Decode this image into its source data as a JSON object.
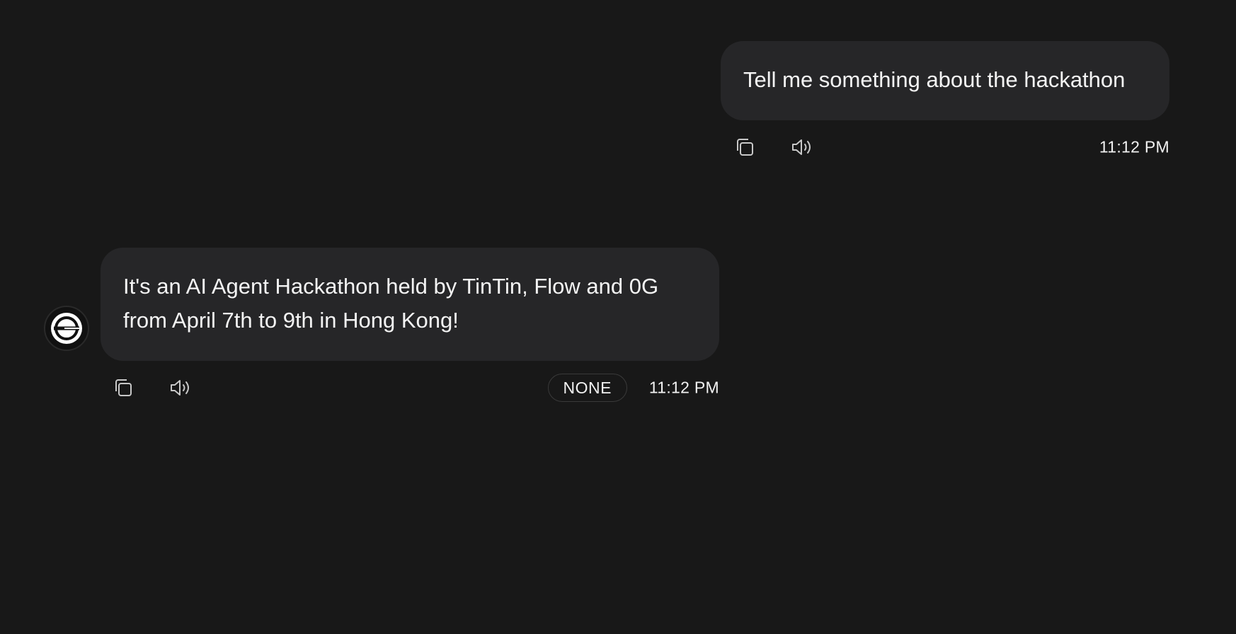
{
  "conversation": {
    "messages": [
      {
        "role": "user",
        "text": "Tell me something about the hackathon",
        "time": "11:12 PM",
        "actions": [
          {
            "icon": "copy-icon"
          },
          {
            "icon": "speaker-icon"
          }
        ]
      },
      {
        "role": "agent",
        "text": "It's an AI Agent Hackathon held by TinTin, Flow and 0G from April 7th to 9th in Hong Kong!",
        "time": "11:12 PM",
        "badge": "NONE",
        "avatar_icon": "agent-logo-icon",
        "actions": [
          {
            "icon": "copy-icon"
          },
          {
            "icon": "speaker-icon"
          }
        ]
      }
    ]
  },
  "colors": {
    "background": "#181818",
    "bubble": "#262628",
    "text": "#f4f4f4",
    "icon": "#c8c8c8"
  }
}
